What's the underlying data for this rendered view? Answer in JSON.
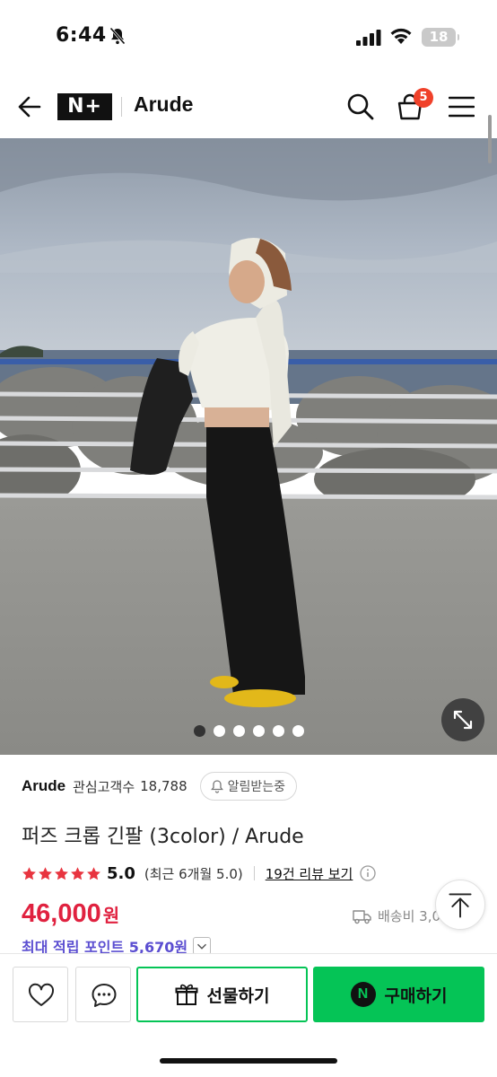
{
  "status_bar": {
    "time": "6:44",
    "battery": "18"
  },
  "header": {
    "logo_text": "N+",
    "store_name": "Arude",
    "cart_count": "5"
  },
  "gallery": {
    "total_images": 6,
    "active_index": 0
  },
  "seller": {
    "name": "Arude",
    "followers_label": "관심고객수",
    "followers_count": "18,788",
    "notify_label": "알림받는중"
  },
  "product": {
    "title": "퍼즈 크롭 긴팔 (3color) / Arude",
    "rating_value": "5.0",
    "rating_stars": 5,
    "rating_recent": "(최근 6개월 5.0)",
    "review_link": "19건 리뷰 보기",
    "price": "46,000",
    "price_unit": "원",
    "shipping": "배송비 3,0",
    "points": "최대 적립 포인트 5,670원"
  },
  "actions": {
    "gift_label": "선물하기",
    "buy_label": "구매하기",
    "buy_icon_text": "N"
  },
  "icons": {
    "back": "arrow-left-icon",
    "search": "search-icon",
    "cart": "shopping-bag-icon",
    "menu": "hamburger-icon",
    "expand": "expand-icon",
    "bell": "bell-icon",
    "star": "star-icon",
    "info": "info-icon",
    "truck": "truck-icon",
    "top": "arrow-up-icon",
    "heart": "heart-icon",
    "chat": "chat-icon",
    "gift": "gift-icon"
  },
  "colors": {
    "price": "#e0213f",
    "points": "#5b4ed1",
    "naver_green": "#05c456",
    "star": "#e8343f",
    "badge": "#f0412a"
  }
}
